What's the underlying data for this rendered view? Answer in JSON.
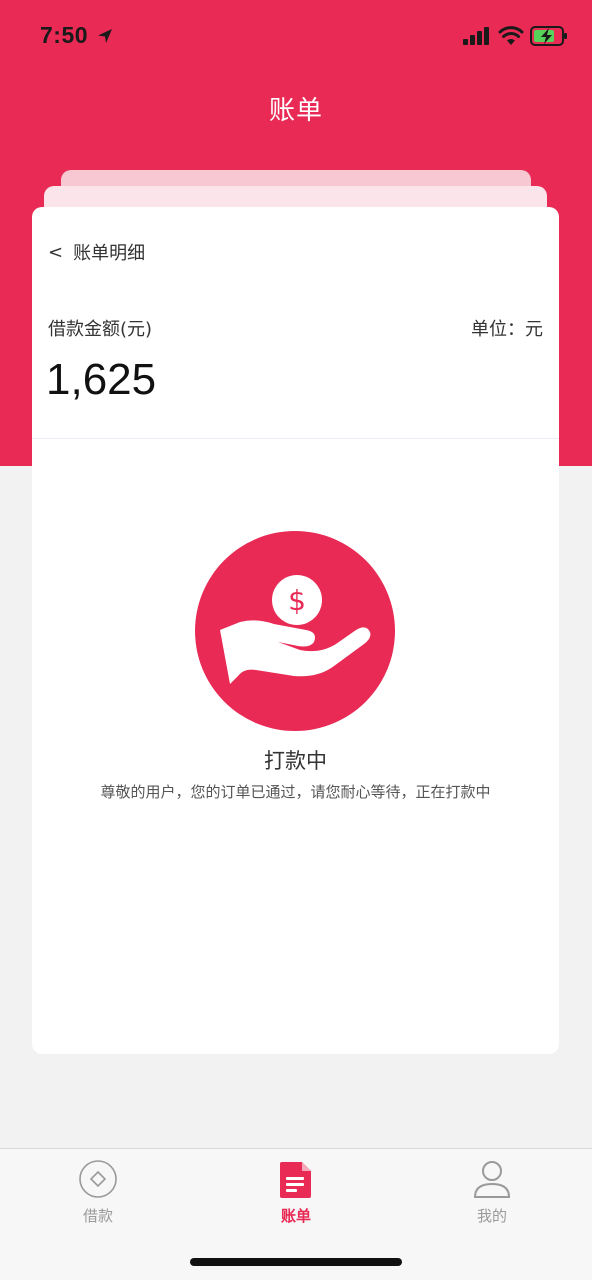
{
  "status_bar": {
    "time": "7:50"
  },
  "header": {
    "title": "账单"
  },
  "card": {
    "back_label": "账单明细",
    "back_chevron": "<",
    "amount_label": "借款金额(元)",
    "unit_label": "单位：元",
    "amount_value": "1,625"
  },
  "state": {
    "icon": "hand-holding-dollar-icon",
    "title": "打款中",
    "description": "尊敬的用户，您的订单已通过，请您耐心等待，正在打款中"
  },
  "tabbar": {
    "tabs": [
      {
        "label": "借款",
        "icon": "coin-icon",
        "active": false
      },
      {
        "label": "账单",
        "icon": "document-icon",
        "active": true
      },
      {
        "label": "我的",
        "icon": "user-icon",
        "active": false
      }
    ]
  },
  "colors": {
    "accent": "#e82a55",
    "inactive": "#9a9a9a"
  }
}
